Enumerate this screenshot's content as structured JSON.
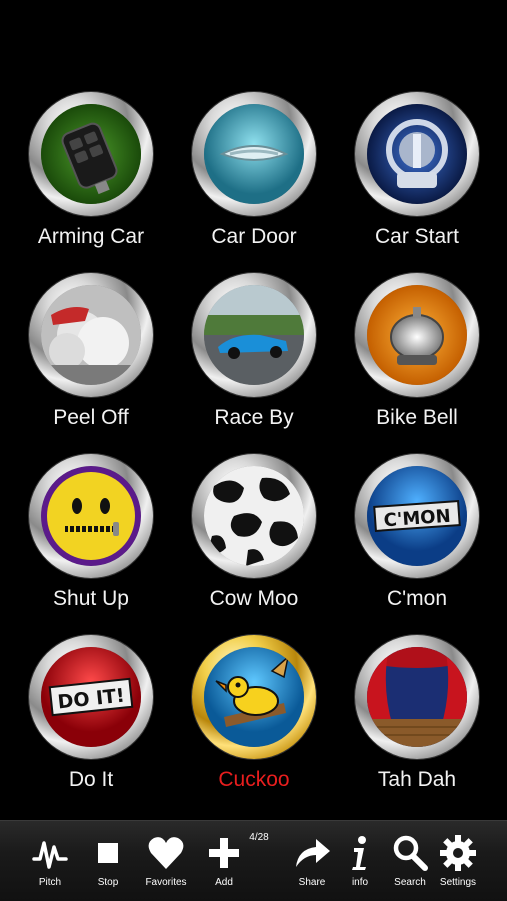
{
  "sounds": [
    {
      "label": "Arming Car",
      "icon": "car-remote-icon",
      "bg": "#2e6b16",
      "active": false
    },
    {
      "label": "Car Door",
      "icon": "car-door-handle-icon",
      "bg": "#3a9fb5",
      "active": false
    },
    {
      "label": "Car Start",
      "icon": "ignition-key-icon",
      "bg": "#1b3d8c",
      "active": false
    },
    {
      "label": "Peel Off",
      "icon": "burnout-smoke-icon",
      "bg": "#c9c9c9",
      "active": false
    },
    {
      "label": "Race By",
      "icon": "race-car-icon",
      "bg": "#6d8f9a",
      "active": false
    },
    {
      "label": "Bike Bell",
      "icon": "bike-bell-icon",
      "bg": "#f08a0c",
      "active": false
    },
    {
      "label": "Shut Up",
      "icon": "zipper-mouth-icon",
      "bg": "#f2d322",
      "active": false
    },
    {
      "label": "Cow Moo",
      "icon": "cow-pattern-icon",
      "bg": "#e8e8e8",
      "active": false
    },
    {
      "label": "C'mon",
      "icon": "cmon-text-icon",
      "bg": "#1d6fc4",
      "active": false
    },
    {
      "label": "Do It",
      "icon": "do-it-text-icon",
      "bg": "#d8141c",
      "active": false
    },
    {
      "label": "Cuckoo",
      "icon": "cuckoo-bird-icon",
      "bg": "#1c8fd1",
      "active": true
    },
    {
      "label": "Tah Dah",
      "icon": "stage-curtain-icon",
      "bg": "#1b2e73",
      "active": false
    }
  ],
  "toolbar": {
    "counter": "4/28",
    "items": [
      {
        "label": "Pitch",
        "icon": "pitch-wave-icon"
      },
      {
        "label": "Stop",
        "icon": "stop-square-icon"
      },
      {
        "label": "Favorites",
        "icon": "heart-icon"
      },
      {
        "label": "Add",
        "icon": "plus-icon"
      },
      {
        "label": "Share",
        "icon": "share-arrow-icon"
      },
      {
        "label": "info",
        "icon": "info-icon"
      },
      {
        "label": "Search",
        "icon": "search-icon"
      },
      {
        "label": "Settings",
        "icon": "gear-icon"
      }
    ]
  },
  "colors": {
    "active_label": "#e81e1e",
    "label": "#f2f2f2",
    "background": "#000000"
  }
}
